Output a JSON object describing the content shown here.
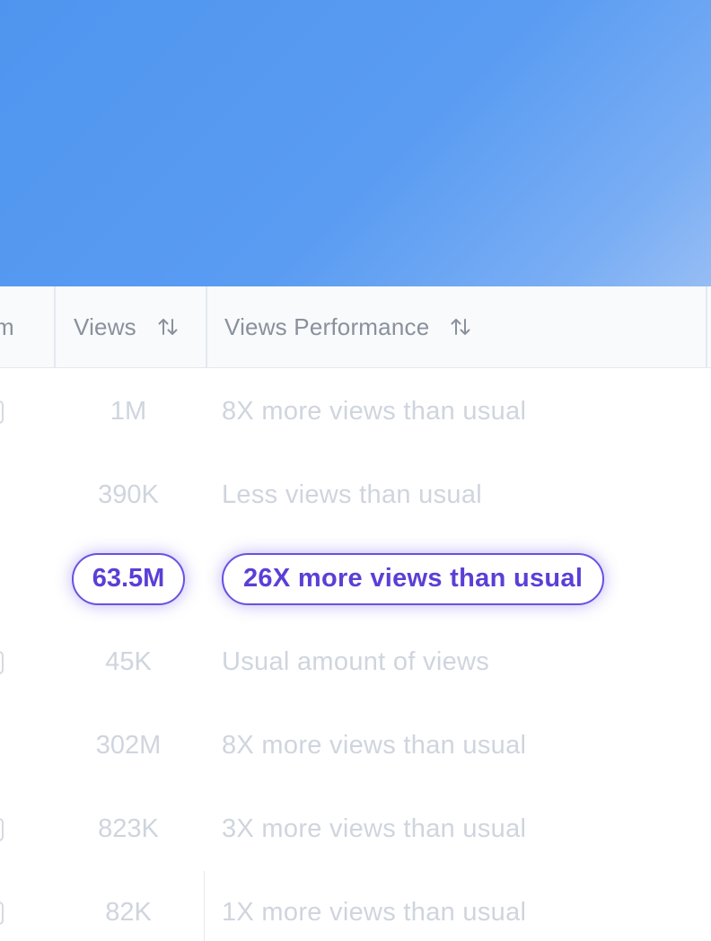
{
  "header": {
    "partial_column_label": "m",
    "views_label": "Views",
    "performance_label": "Views Performance"
  },
  "rows": [
    {
      "views": "1M",
      "performance": "8X more views than usual",
      "highlighted": false
    },
    {
      "views": "390K",
      "performance": "Less views than usual",
      "highlighted": false
    },
    {
      "views": "63.5M",
      "performance": "26X more views than usual",
      "highlighted": true
    },
    {
      "views": "45K",
      "performance": "Usual amount of views",
      "highlighted": false
    },
    {
      "views": "302M",
      "performance": "8X more views than usual",
      "highlighted": false
    },
    {
      "views": "823K",
      "performance": "3X more views than usual",
      "highlighted": false
    },
    {
      "views": "82K",
      "performance": "1X more views than usual",
      "highlighted": false
    }
  ],
  "colors": {
    "hero_start": "#4f95ef",
    "hero_end": "#96bdf4",
    "highlight_accent": "#5b3fd6",
    "muted_text": "#cfd5de",
    "header_text": "#8a919c"
  },
  "icons": {
    "sort": "sort-arrows-icon"
  }
}
